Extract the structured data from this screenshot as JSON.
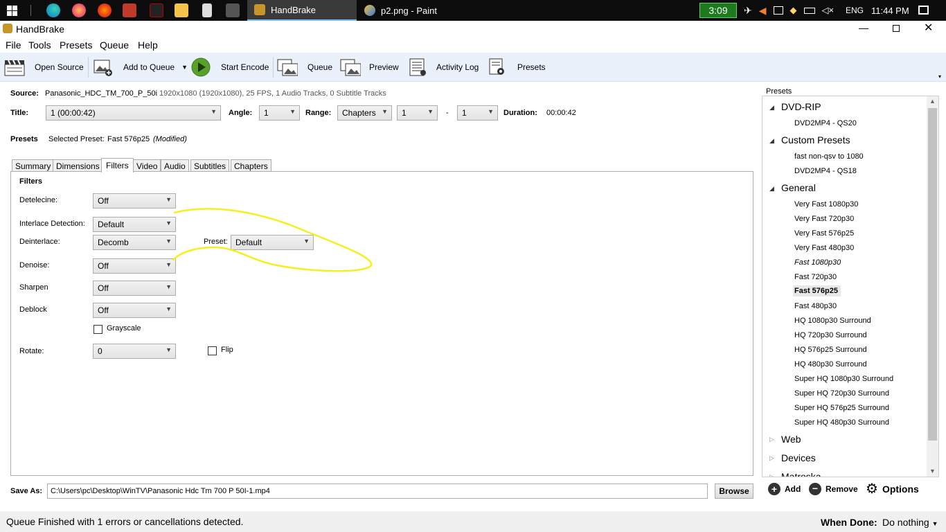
{
  "taskbar": {
    "apps": [
      {
        "label": "HandBrake",
        "active": true
      },
      {
        "label": "p2.png - Paint",
        "active": false
      }
    ],
    "timer": "3:09",
    "language": "ENG",
    "clock": "11:44 PM"
  },
  "window": {
    "title": "HandBrake"
  },
  "menu": [
    "File",
    "Tools",
    "Presets",
    "Queue",
    "Help"
  ],
  "toolbar": {
    "open_source": "Open Source",
    "add_to_queue": "Add to Queue",
    "start_encode": "Start Encode",
    "queue": "Queue",
    "preview": "Preview",
    "activity_log": "Activity Log",
    "presets": "Presets"
  },
  "source": {
    "label": "Source:",
    "name": "Panasonic_HDC_TM_700_P_50i",
    "info": "1920x1080 (1920x1080), 25 FPS, 1 Audio Tracks, 0 Subtitle Tracks"
  },
  "title_row": {
    "title_label": "Title:",
    "title_value": "1 (00:00:42)",
    "angle_label": "Angle:",
    "angle_value": "1",
    "range_label": "Range:",
    "range_value": "Chapters",
    "range_start": "1",
    "range_sep": "-",
    "range_end": "1",
    "duration_label": "Duration:",
    "duration_value": "00:00:42"
  },
  "presets_row": {
    "label": "Presets",
    "selected_label": "Selected Preset:",
    "selected_value": "Fast 576p25",
    "modified": "(Modified)"
  },
  "tabs": [
    "Summary",
    "Dimensions",
    "Filters",
    "Video",
    "Audio",
    "Subtitles",
    "Chapters"
  ],
  "filters": {
    "heading": "Filters",
    "detelecine_label": "Detelecine:",
    "detelecine_value": "Off",
    "interlace_label": "Interlace Detection:",
    "interlace_value": "Default",
    "deinterlace_label": "Deinterlace:",
    "deinterlace_value": "Decomb",
    "preset_label": "Preset:",
    "preset_value": "Default",
    "denoise_label": "Denoise:",
    "denoise_value": "Off",
    "sharpen_label": "Sharpen",
    "sharpen_value": "Off",
    "deblock_label": "Deblock",
    "deblock_value": "Off",
    "grayscale_label": "Grayscale",
    "rotate_label": "Rotate:",
    "rotate_value": "0",
    "flip_label": "Flip"
  },
  "save_as": {
    "label": "Save As:",
    "path": "C:\\Users\\pc\\Desktop\\WinTV\\Panasonic Hdc Tm 700 P 50I-1.mp4",
    "browse": "Browse"
  },
  "preset_panel": {
    "heading": "Presets",
    "groups": {
      "dvd_rip": "DVD-RIP",
      "custom": "Custom Presets",
      "general": "General",
      "web": "Web",
      "devices": "Devices",
      "matroska": "Matroska"
    },
    "dvd_rip_items": [
      "DVD2MP4 - QS20"
    ],
    "custom_items": [
      "fast non-qsv to 1080",
      "DVD2MP4 - QS18"
    ],
    "general_items": [
      "Very Fast 1080p30",
      "Very Fast 720p30",
      "Very Fast 576p25",
      "Very Fast 480p30",
      "Fast 1080p30",
      "Fast 720p30",
      "Fast 576p25",
      "Fast 480p30",
      "HQ 1080p30 Surround",
      "HQ 720p30 Surround",
      "HQ 576p25 Surround",
      "HQ 480p30 Surround",
      "Super HQ 1080p30 Surround",
      "Super HQ 720p30 Surround",
      "Super HQ 576p25 Surround",
      "Super HQ 480p30 Surround"
    ],
    "add": "Add",
    "remove": "Remove",
    "options": "Options"
  },
  "status": {
    "message": "Queue Finished with 1 errors or cancellations detected.",
    "when_done_label": "When Done:",
    "when_done_value": "Do nothing"
  },
  "colors": {
    "taskbar": "#0c0c0c",
    "toolbar": "#eaf1fb",
    "annotation": "#f5ef1f",
    "timer": "#1f7a1f"
  }
}
